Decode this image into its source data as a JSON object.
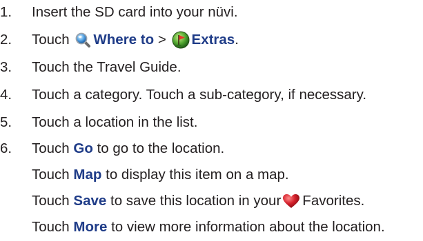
{
  "steps": [
    {
      "num": "1.",
      "text": "Insert the SD card into your nüvi."
    },
    {
      "num": "2.",
      "pre": "Touch",
      "where_to": "Where to",
      "sep": ">",
      "extras": "Extras",
      "end": "."
    },
    {
      "num": "3.",
      "text": "Touch the Travel Guide."
    },
    {
      "num": "4.",
      "text": "Touch a category. Touch a sub-category, if necessary."
    },
    {
      "num": "5.",
      "text": "Touch a location in the list."
    },
    {
      "num": "6.",
      "pre": "Touch",
      "go": "Go",
      "rest": "to go to the location."
    }
  ],
  "subs": {
    "map": {
      "pre": "Touch",
      "kw": "Map",
      "rest": "to display this item on a map."
    },
    "save": {
      "pre": "Touch",
      "kw": "Save",
      "rest": "to save this location in your",
      "after": "Favorites."
    },
    "more": {
      "pre": "Touch",
      "kw": "More",
      "rest": "to view more information about the location."
    }
  },
  "icons": {
    "where_to": "magnifier-icon",
    "extras": "flag-disc-icon",
    "favorites": "heart-icon"
  },
  "colors": {
    "keyword": "#1f3c88",
    "text": "#231f20",
    "heart": "#d4202b"
  }
}
